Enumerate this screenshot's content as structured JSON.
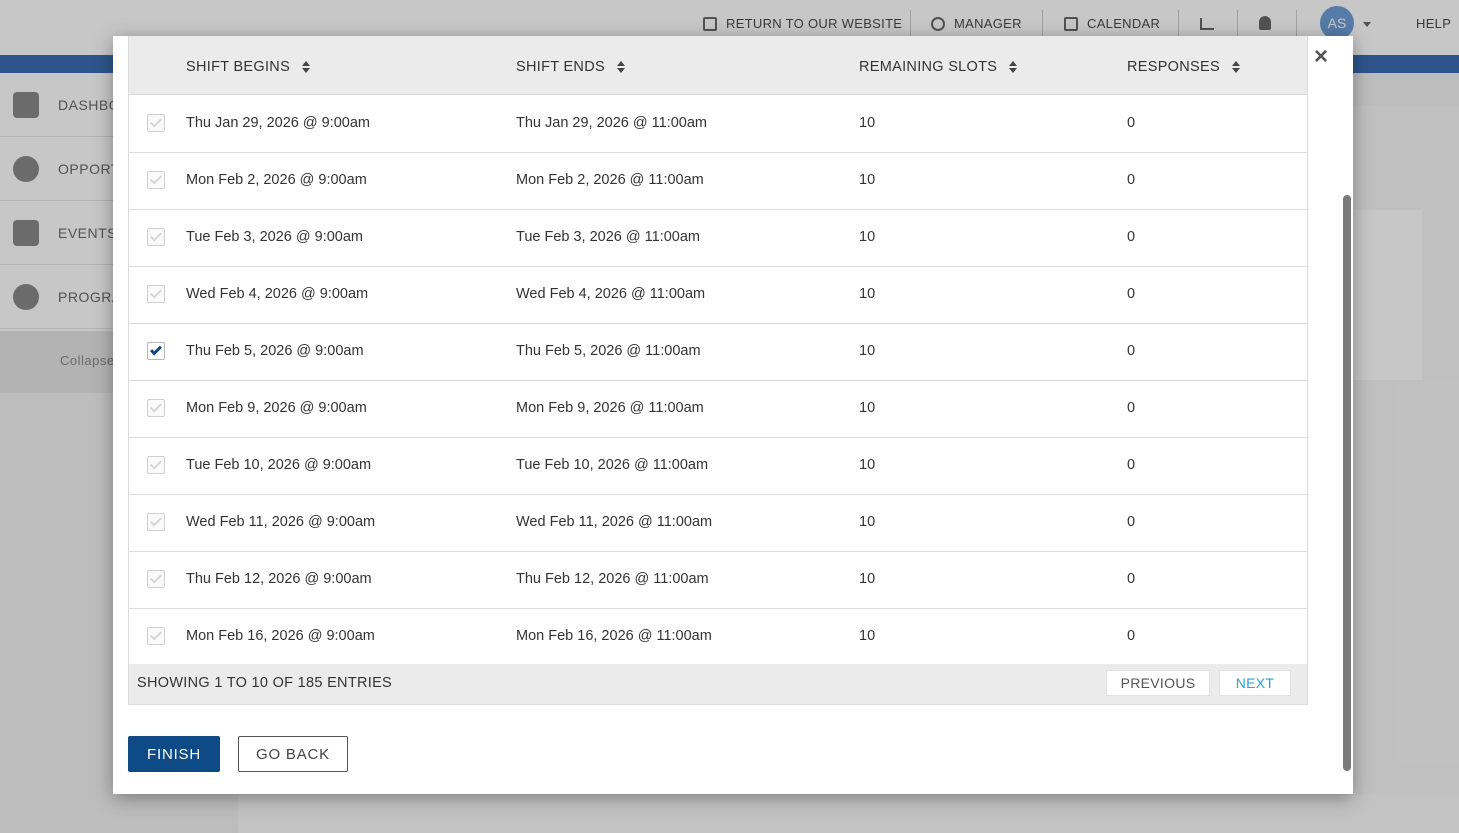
{
  "header": {
    "return_link": "RETURN TO OUR WEBSITE",
    "manager": "MANAGER",
    "calendar": "CALENDAR",
    "avatar_initials": "AS",
    "help": "HELP"
  },
  "sidebar": {
    "items": [
      {
        "label": "DASHBO",
        "icon": "home-icon"
      },
      {
        "label": "OPPORT",
        "icon": "check-circle-icon"
      },
      {
        "label": "EVENTS",
        "icon": "calendar-icon"
      },
      {
        "label": "PROGRA",
        "icon": "hand-icon"
      }
    ],
    "collapse_label": "Collapse"
  },
  "modal": {
    "close_label": "×",
    "columns": [
      {
        "label": "SHIFT BEGINS"
      },
      {
        "label": "SHIFT ENDS"
      },
      {
        "label": "REMAINING SLOTS"
      },
      {
        "label": "RESPONSES"
      }
    ],
    "rows": [
      {
        "begins": "Thu Jan 29, 2026 @ 9:00am",
        "ends": "Thu Jan 29, 2026 @ 11:00am",
        "slots": "10",
        "responses": "0",
        "checked": false
      },
      {
        "begins": "Mon Feb 2, 2026 @ 9:00am",
        "ends": "Mon Feb 2, 2026 @ 11:00am",
        "slots": "10",
        "responses": "0",
        "checked": false
      },
      {
        "begins": "Tue Feb 3, 2026 @ 9:00am",
        "ends": "Tue Feb 3, 2026 @ 11:00am",
        "slots": "10",
        "responses": "0",
        "checked": false
      },
      {
        "begins": "Wed Feb 4, 2026 @ 9:00am",
        "ends": "Wed Feb 4, 2026 @ 11:00am",
        "slots": "10",
        "responses": "0",
        "checked": false
      },
      {
        "begins": "Thu Feb 5, 2026 @ 9:00am",
        "ends": "Thu Feb 5, 2026 @ 11:00am",
        "slots": "10",
        "responses": "0",
        "checked": true
      },
      {
        "begins": "Mon Feb 9, 2026 @ 9:00am",
        "ends": "Mon Feb 9, 2026 @ 11:00am",
        "slots": "10",
        "responses": "0",
        "checked": false
      },
      {
        "begins": "Tue Feb 10, 2026 @ 9:00am",
        "ends": "Tue Feb 10, 2026 @ 11:00am",
        "slots": "10",
        "responses": "0",
        "checked": false
      },
      {
        "begins": "Wed Feb 11, 2026 @ 9:00am",
        "ends": "Wed Feb 11, 2026 @ 11:00am",
        "slots": "10",
        "responses": "0",
        "checked": false
      },
      {
        "begins": "Thu Feb 12, 2026 @ 9:00am",
        "ends": "Thu Feb 12, 2026 @ 11:00am",
        "slots": "10",
        "responses": "0",
        "checked": false
      },
      {
        "begins": "Mon Feb 16, 2026 @ 9:00am",
        "ends": "Mon Feb 16, 2026 @ 11:00am",
        "slots": "10",
        "responses": "0",
        "checked": false
      }
    ],
    "entries_info": "SHOWING 1 TO 10 OF 185 ENTRIES",
    "previous_label": "PREVIOUS",
    "next_label": "NEXT",
    "finish_label": "FINISH",
    "go_back_label": "GO BACK"
  },
  "colors": {
    "primary": "#0d4a86",
    "link": "#2a9fd6",
    "header_bg": "#ebebeb"
  }
}
